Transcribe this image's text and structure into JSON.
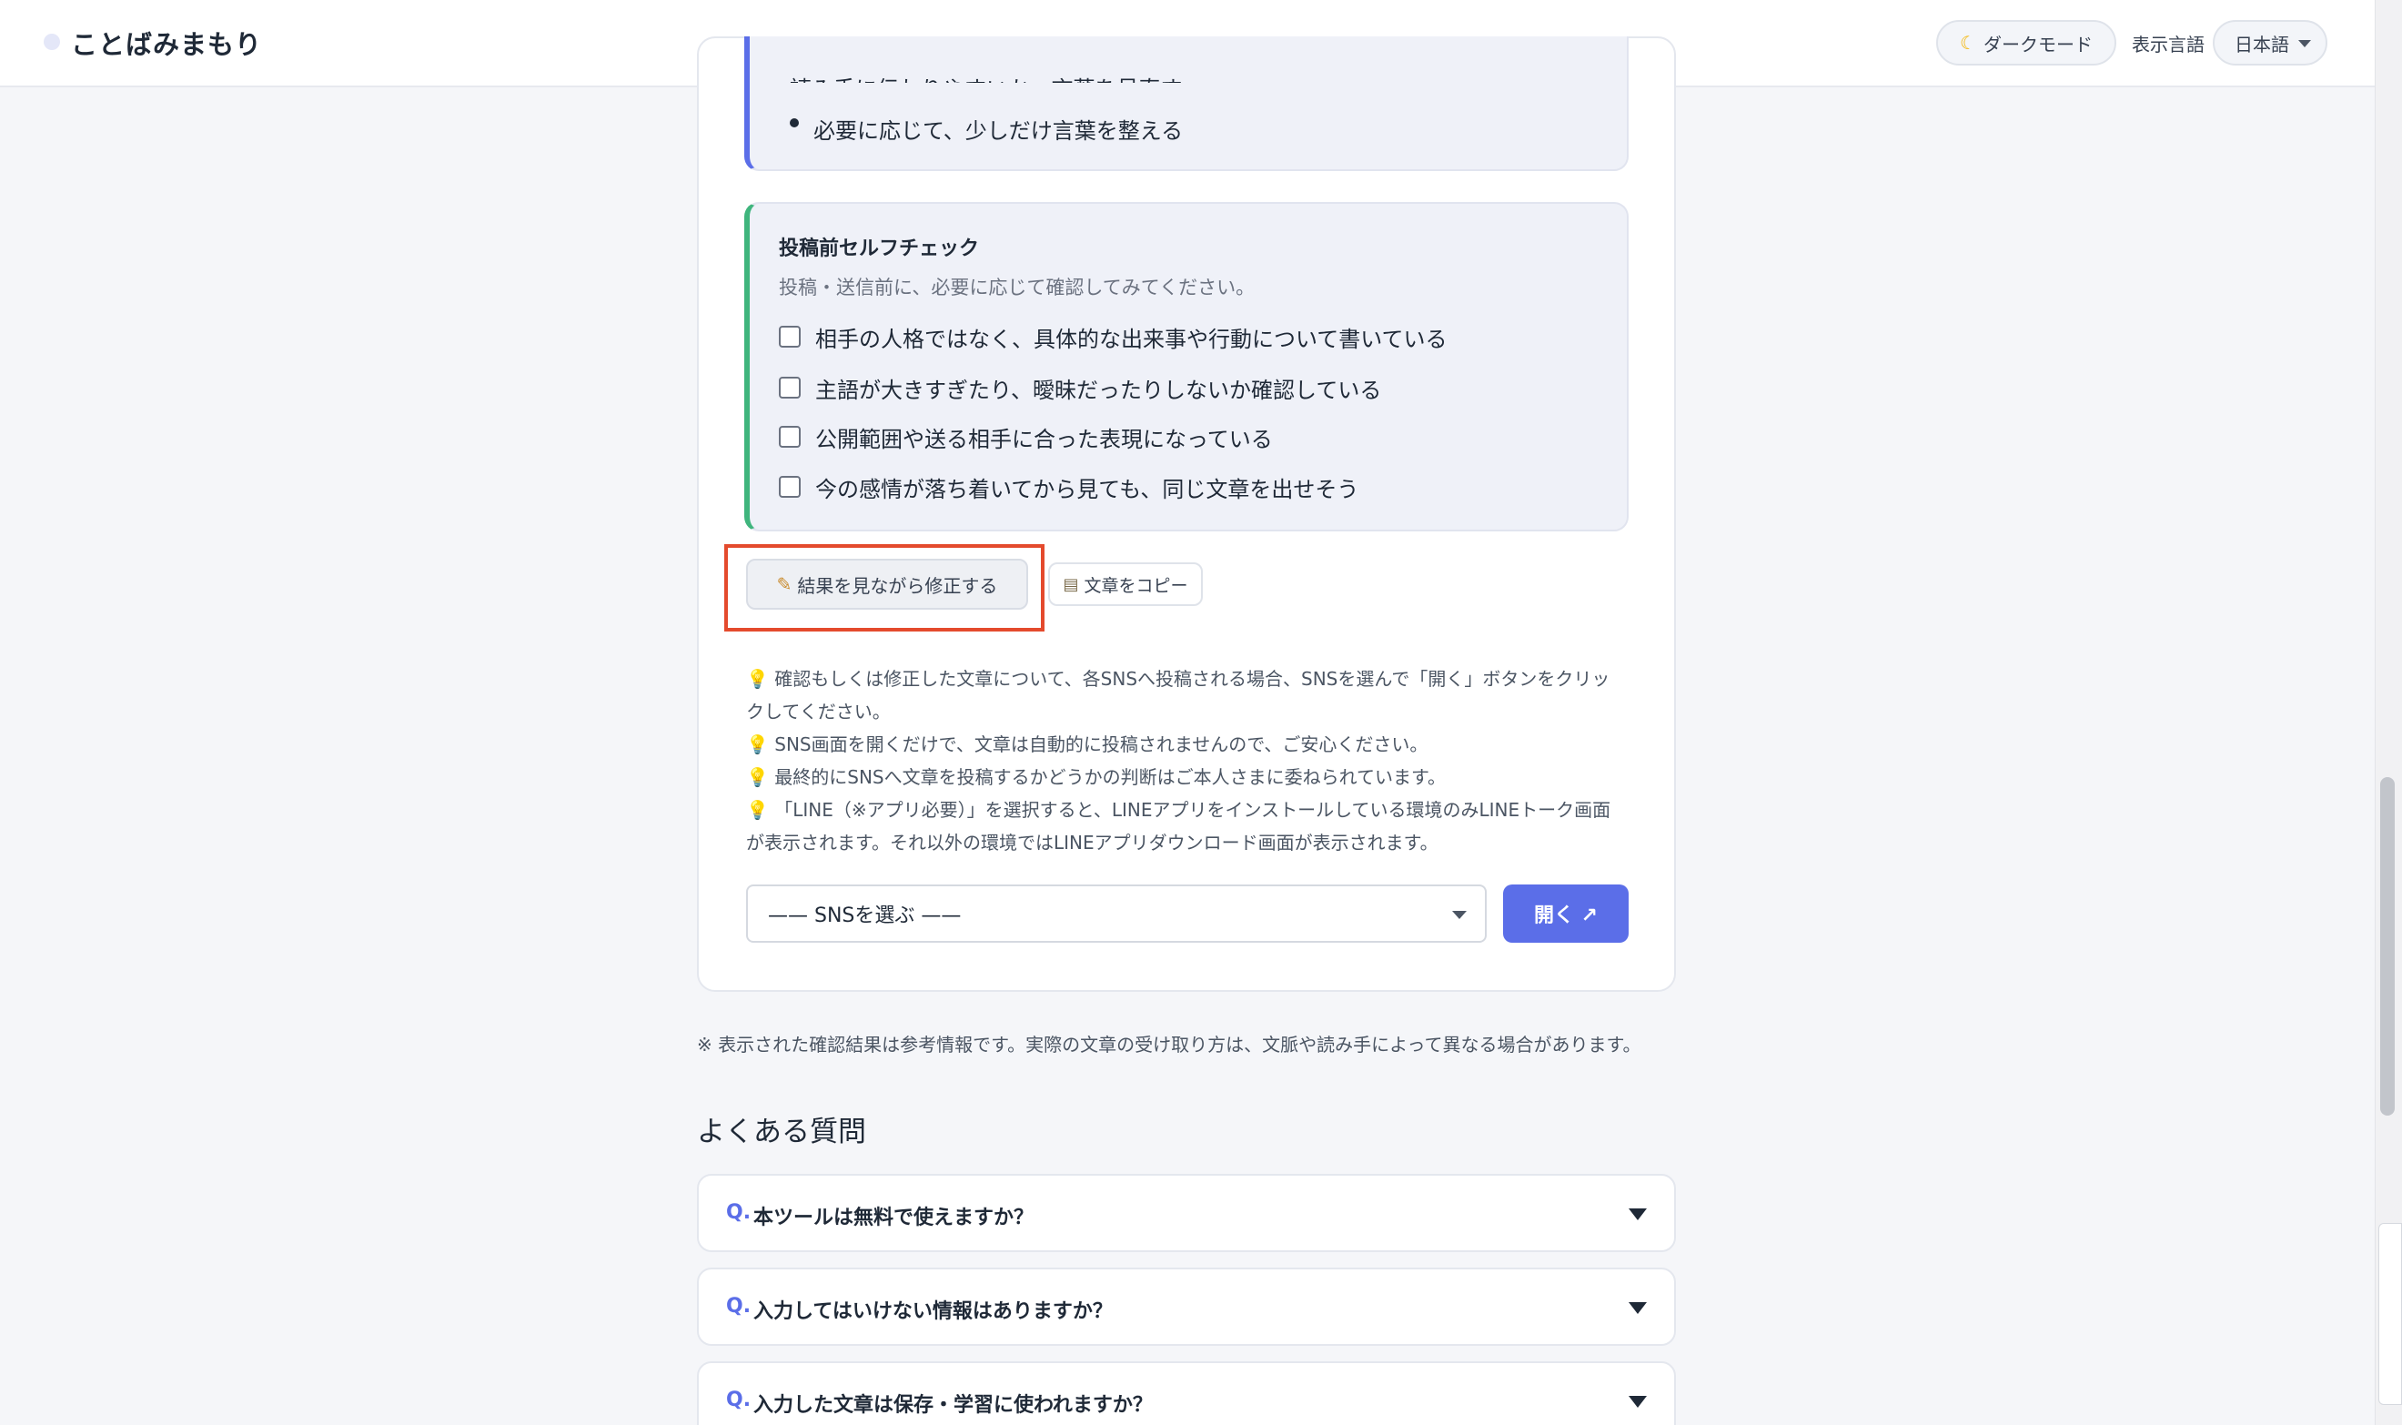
{
  "header": {
    "brand": "ことばみまもり",
    "dark_mode_label": "ダークモード",
    "language_label": "表示言語",
    "language_value": "日本語"
  },
  "points": {
    "partial_line": "読み手に伝わりやすいか、言葉を見直す",
    "last_item": "必要に応じて、少しだけ言葉を整える"
  },
  "self_check": {
    "title": "投稿前セルフチェック",
    "subtitle": "投稿・送信前に、必要に応じて確認してみてください。",
    "items": [
      "相手の人格ではなく、具体的な出来事や行動について書いている",
      "主語が大きすぎたり、曖昧だったりしないか確認している",
      "公開範囲や送る相手に合った表現になっている",
      "今の感情が落ち着いてから見ても、同じ文章を出せそう"
    ]
  },
  "actions": {
    "edit_label": "結果を見ながら修正する",
    "copy_label": "文章をコピー"
  },
  "tips": {
    "line1a": "確認もしくは修正した文章について、各SNSへ投稿される場合、SNSを選んで「開く」ボタンをクリッ",
    "line1b": "クしてください。",
    "line2": "SNS画面を開くだけで、文章は自動的に投稿されませんので、ご安心ください。",
    "line3": "最終的にSNSへ文章を投稿するかどうかの判断はご本人さまに委ねられています。",
    "line4a": "「LINE（※アプリ必要）」を選択すると、LINEアプリをインストールしている環境のみLINEトーク画面",
    "line4b": "が表示されます。それ以外の環境ではLINEアプリダウンロード画面が表示されます。"
  },
  "sns": {
    "select_value": "—— SNSを選ぶ ——",
    "open_label": "開く ↗"
  },
  "disclaimer": "※ 表示された確認結果は参考情報です。実際の文章の受け取り方は、文脈や読み手によって異なる場合があります。",
  "faq": {
    "heading": "よくある質問",
    "q_prefix": "Q.",
    "items": [
      "本ツールは無料で使えますか？",
      "入力してはいけない情報はありますか？",
      "入力した文章は保存・学習に使われますか？"
    ]
  },
  "icons": {
    "dark_mode": "moon-icon",
    "edit": "pencil-icon",
    "copy": "clipboard-icon",
    "tip": "lightbulb-icon"
  },
  "colors": {
    "accent": "#5b6ee8",
    "check_border": "#3fb57d",
    "highlight": "#e44a2d"
  }
}
